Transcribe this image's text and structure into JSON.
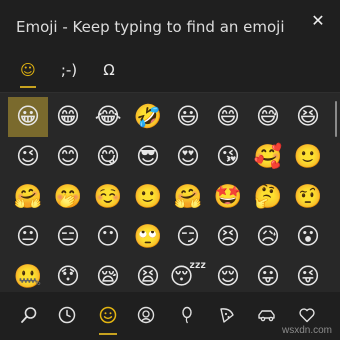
{
  "window": {
    "title": "Emoji - Keep typing to find an emoji",
    "close_glyph": "✕"
  },
  "top_tabs": [
    {
      "name": "tab-emoji",
      "glyph": "☺",
      "active": true
    },
    {
      "name": "tab-kaomoji",
      "glyph": ";-)",
      "active": false
    },
    {
      "name": "tab-symbols",
      "glyph": "Ω",
      "active": false
    }
  ],
  "emoji_grid": [
    [
      "😀",
      "😁",
      "😂",
      "🤣",
      "😃",
      "😄",
      "😅",
      "😆"
    ],
    [
      "😉",
      "😊",
      "😋",
      "😎",
      "😍",
      "😘",
      "🥰",
      "🙂"
    ],
    [
      "🤗",
      "🤭",
      "☺️",
      "🙂",
      "🤗",
      "🤩",
      "🤔",
      "🤨"
    ],
    [
      "😐",
      "😑",
      "😶",
      "🙄",
      "😏",
      "😣",
      "😥",
      "😮"
    ],
    [
      "🤐",
      "😯",
      "😪",
      "😫",
      "😴",
      "😌",
      "😛",
      "😜"
    ]
  ],
  "selected_cell": [
    0,
    0
  ],
  "bottom_tabs": [
    {
      "name": "search",
      "glyph": "🔍"
    },
    {
      "name": "recent",
      "glyph": "🕒"
    },
    {
      "name": "smileys",
      "glyph": "☺",
      "active": true
    },
    {
      "name": "people",
      "glyph": "👤"
    },
    {
      "name": "celebrations",
      "glyph": "🎈"
    },
    {
      "name": "food",
      "glyph": "🍕"
    },
    {
      "name": "travel",
      "glyph": "🚗"
    },
    {
      "name": "symbols",
      "glyph": "♡"
    }
  ],
  "colors": {
    "accent": "#e3b511",
    "selected_bg": "#7a6a2d",
    "background": "#1f1f1f",
    "grid_background": "#282828"
  },
  "watermark": "wsxdn.com"
}
